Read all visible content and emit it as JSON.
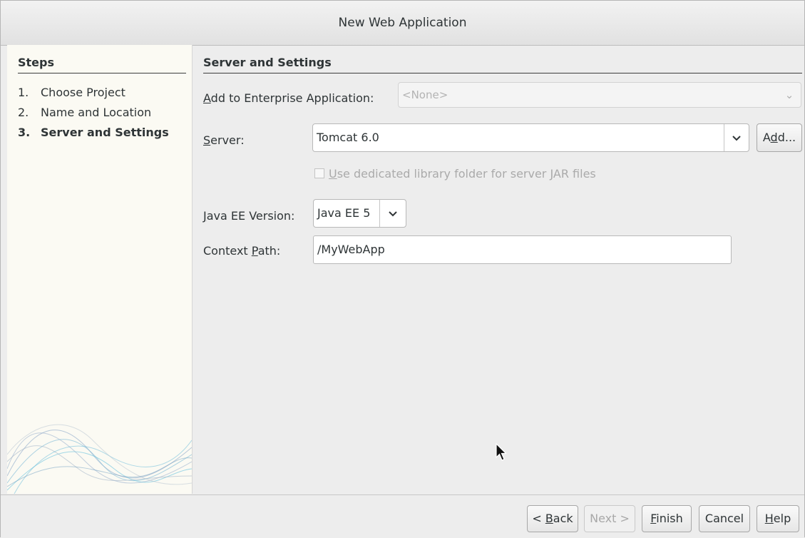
{
  "window": {
    "title": "New Web Application"
  },
  "steps": {
    "heading": "Steps",
    "items": [
      {
        "num": "1.",
        "label": "Choose Project"
      },
      {
        "num": "2.",
        "label": "Name and Location"
      },
      {
        "num": "3.",
        "label": "Server and Settings"
      }
    ]
  },
  "panel": {
    "heading": "Server and Settings",
    "enterprise": {
      "label_pre": "",
      "label_key": "A",
      "label_post": "dd to Enterprise Application:",
      "value": "<None>"
    },
    "server": {
      "label_pre": "",
      "label_key": "S",
      "label_post": "erver:",
      "value": "Tomcat 6.0",
      "add_pre": "A",
      "add_key": "d",
      "add_post": "d..."
    },
    "library": {
      "label_pre": "",
      "label_key": "U",
      "label_post": "se dedicated library folder for server JAR files"
    },
    "javaee": {
      "label_pre": "",
      "label_key": "J",
      "label_post": "ava EE Version:",
      "value": "Java EE 5"
    },
    "context": {
      "label_pre": "Context ",
      "label_key": "P",
      "label_post": "ath:",
      "value": "/MyWebApp"
    }
  },
  "footer": {
    "back": {
      "pre": "< ",
      "key": "B",
      "post": "ack"
    },
    "next": "Next >",
    "finish": {
      "pre": "",
      "key": "F",
      "post": "inish"
    },
    "cancel": "Cancel",
    "help": {
      "pre": "",
      "key": "H",
      "post": "elp"
    }
  },
  "icons": {
    "chevron": "chevron-down-icon",
    "cursor": "mouse-pointer-icon"
  }
}
